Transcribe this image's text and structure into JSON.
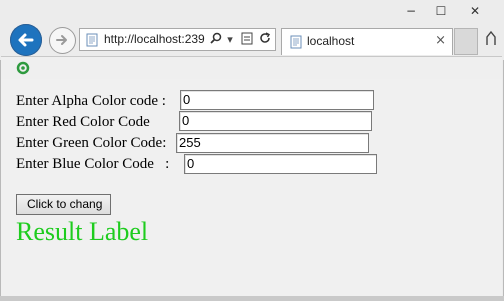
{
  "window": {
    "minimize_glyph": "−",
    "maximize_glyph": "☐",
    "close_glyph": "✕"
  },
  "addressbar": {
    "url": "http://localhost:239"
  },
  "tab": {
    "title": "localhost",
    "close_glyph": "×"
  },
  "form": {
    "alpha_label": "Enter Alpha Color code : ",
    "alpha_value": "0",
    "red_label": "Enter Red Color Code     ",
    "red_value": "0",
    "green_label": "Enter Green Color Code:",
    "green_value": "255",
    "blue_label": "Enter Blue Color Code   :",
    "blue_value": "0",
    "button_label": "Click to chang",
    "result_label": "Result Label"
  },
  "colors": {
    "result": "#1ecc1e",
    "back_button": "#1e73be"
  },
  "icons": {
    "back": "arrow-left-icon",
    "forward": "arrow-right-icon",
    "page": "page-icon",
    "search": "search-icon",
    "dropdown": "chevron-down-icon",
    "compat": "compatibility-icon",
    "refresh": "refresh-icon",
    "home": "home-icon",
    "favorites_logo": "ie-logo-icon"
  }
}
